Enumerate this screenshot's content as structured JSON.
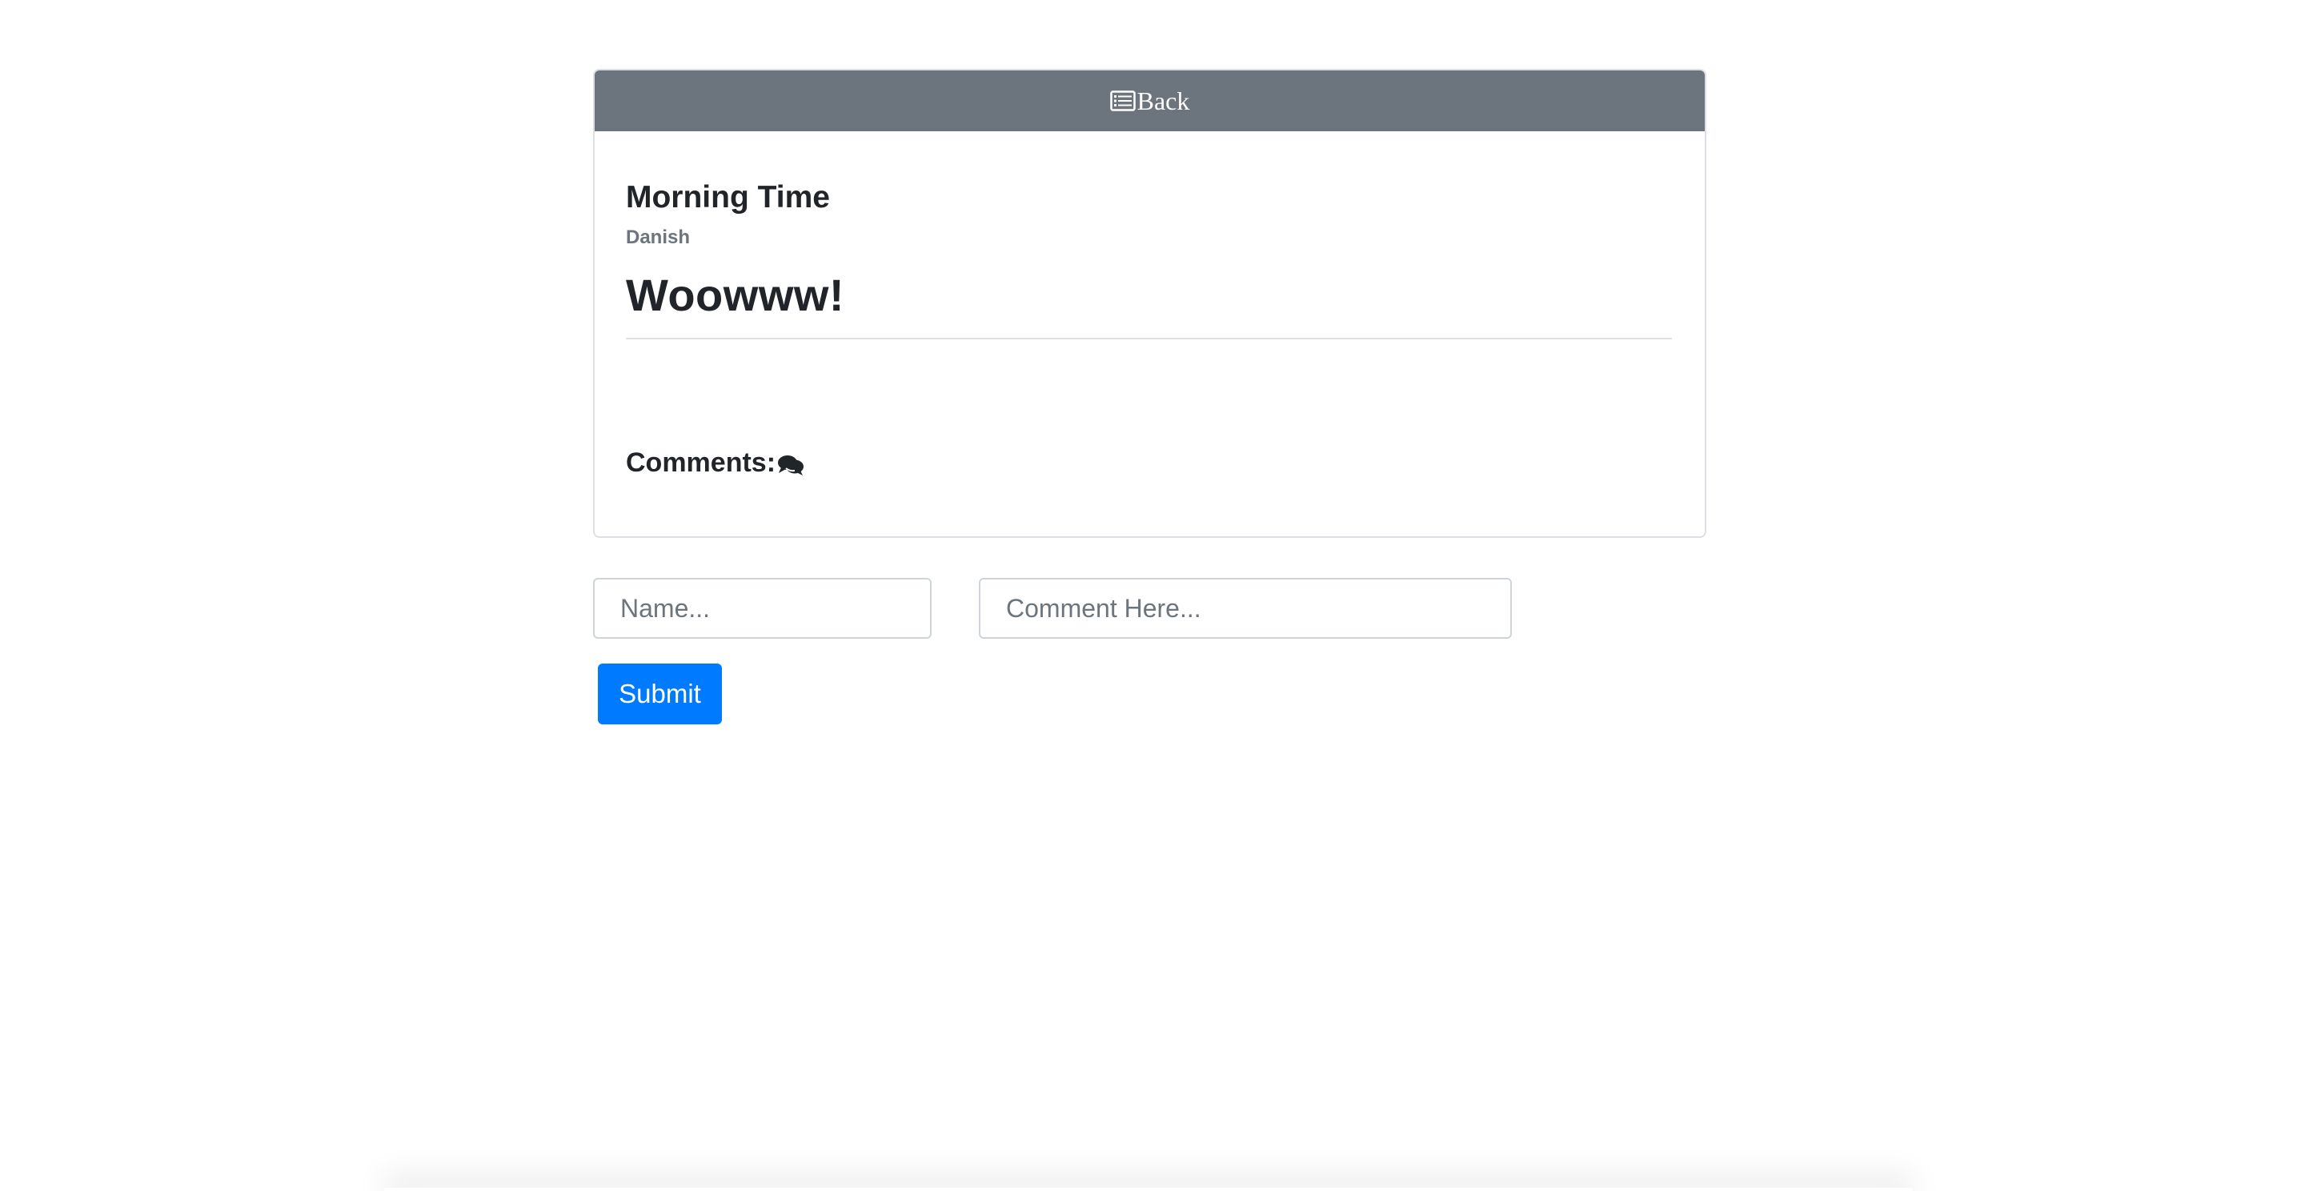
{
  "header": {
    "back_label": "Back",
    "back_icon": "list-alt-icon"
  },
  "post": {
    "title": "Morning Time",
    "author": "Danish",
    "body": "Woowww!"
  },
  "comments": {
    "heading": "Comments:",
    "icon": "comments-icon"
  },
  "form": {
    "name_placeholder": "Name...",
    "comment_placeholder": "Comment Here...",
    "submit_label": "Submit"
  },
  "colors": {
    "header_bg": "#6c757d",
    "primary": "#007bff",
    "muted_text": "#6c757d",
    "text": "#212529"
  }
}
